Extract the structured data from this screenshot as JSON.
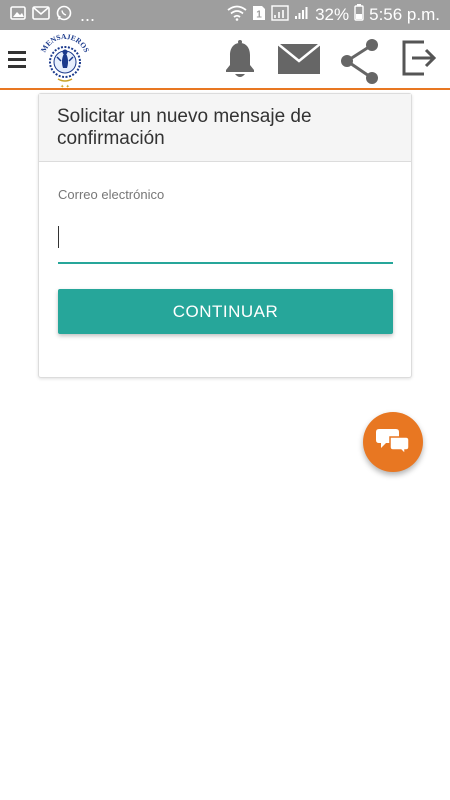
{
  "status_bar": {
    "dots": "...",
    "sim_badge": "1",
    "battery_percent": "32%",
    "time": "5:56 p.m."
  },
  "app_bar": {
    "logo_text": "MENSAJEROS",
    "icons": [
      "menu-icon",
      "bell-icon",
      "mail-icon",
      "share-icon",
      "logout-icon"
    ]
  },
  "card": {
    "title": "Solicitar un nuevo mensaje de confirmación",
    "email_label": "Correo electrónico",
    "email_value": "",
    "button_label": "CONTINUAR"
  },
  "fab": {
    "icon": "chat-bubbles-icon"
  },
  "colors": {
    "accent": "#e87722",
    "teal": "#26a69a",
    "status_bar": "#9e9e9e"
  }
}
